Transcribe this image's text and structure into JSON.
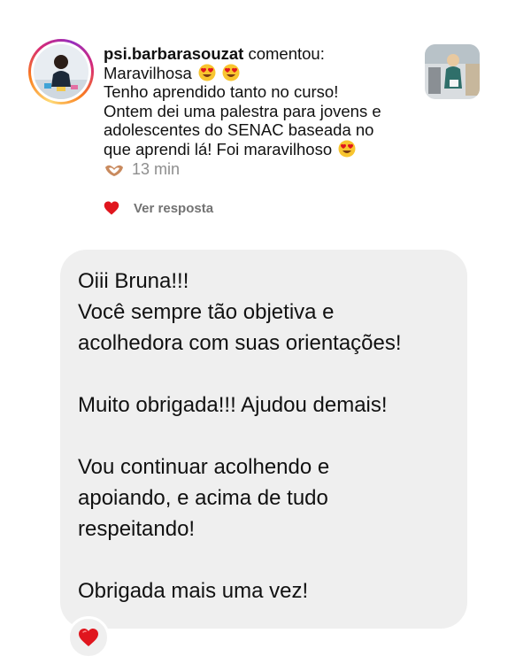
{
  "comment": {
    "username": "psi.barbarasouzat",
    "action": "comentou:",
    "lines": [
      "Maravilhosa",
      "Tenho aprendido tanto no curso!",
      "Ontem dei uma palestra para jovens e",
      "adolescentes do SENAC baseada no",
      "que aprendi lá! Foi maravilhoso"
    ],
    "time": "13 min",
    "reply_label": "Ver resposta",
    "icons": {
      "emoji": "heart-eyes-emoji",
      "hands": "heart-hands-emoji",
      "like": "heart-icon"
    }
  },
  "message": {
    "paragraphs": [
      [
        "Oiii Bruna!!!",
        "Você sempre tão objetiva e",
        "acolhedora com suas orientações!"
      ],
      [
        "Muito obrigada!!! Ajudou demais!"
      ],
      [
        "Vou continuar acolhendo e",
        "apoiando, e acima de tudo",
        "respeitando!"
      ],
      [
        "Obrigada mais uma vez!"
      ]
    ],
    "reaction_icon": "heart-reaction-icon"
  },
  "colors": {
    "like_red": "#e0161e",
    "bubble_bg": "#efefef",
    "muted_text": "#8e8e8e"
  }
}
